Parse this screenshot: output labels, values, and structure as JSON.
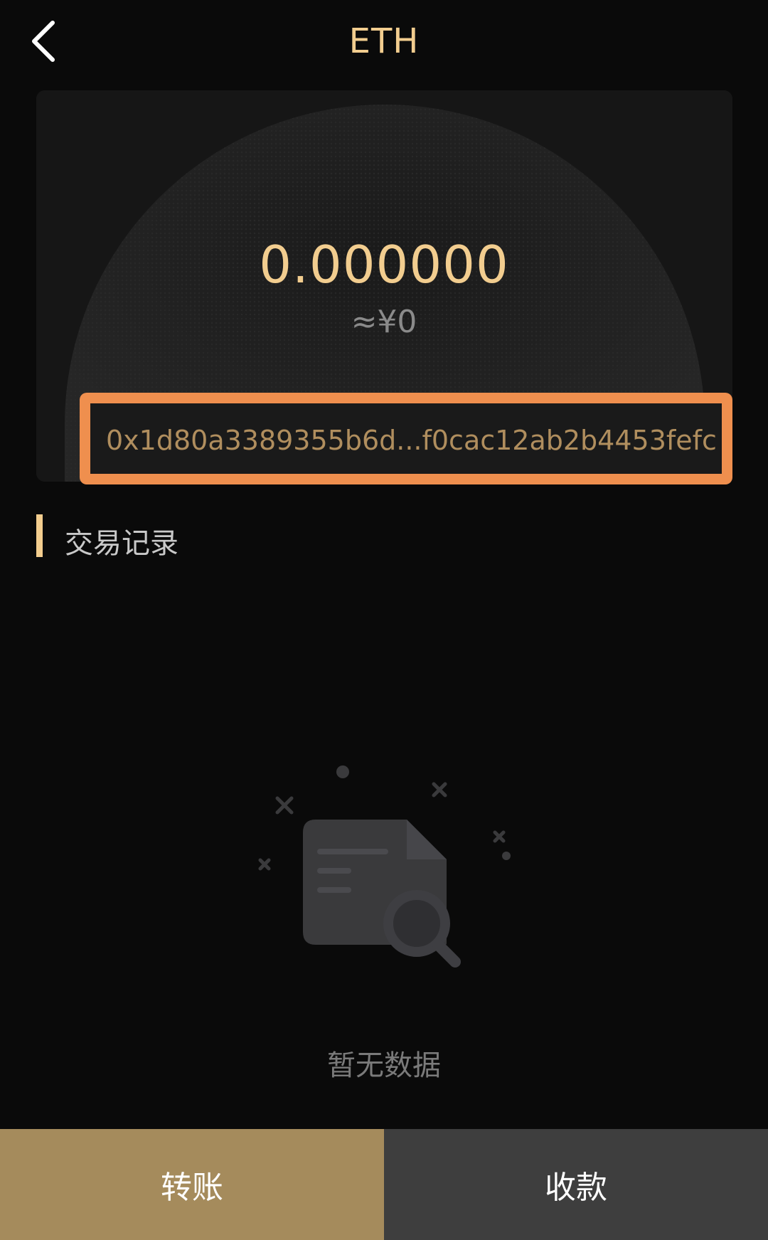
{
  "header": {
    "title": "ETH",
    "back_icon": "chevron-left-icon"
  },
  "wallet": {
    "balance": "0.000000",
    "fiat_value": "≈¥0",
    "address": "0x1d80a3389355b6d...f0cac12ab2b4453fefc"
  },
  "transactions": {
    "section_title": "交易记录",
    "empty_icon": "empty-document-search-icon",
    "empty_text": "暂无数据"
  },
  "actions": {
    "transfer_label": "转账",
    "receive_label": "收款"
  },
  "colors": {
    "background": "#0a0a0a",
    "accent_gold": "#f2cd8f",
    "highlight_orange": "#ef8f4e",
    "transfer_button": "#a58b5c",
    "receive_button": "#3e3e3e"
  }
}
